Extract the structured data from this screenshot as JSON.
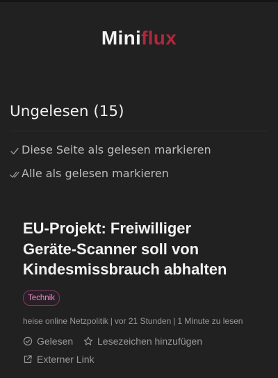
{
  "logo": {
    "part1": "Mini",
    "part2": "flux",
    "accent_color": "#b3273a"
  },
  "page": {
    "title": "Ungelesen (15)",
    "actions": [
      {
        "label": "Diese Seite als gelesen markieren",
        "icon": "check-icon"
      },
      {
        "label": "Alle als gelesen markieren",
        "icon": "double-check-icon"
      }
    ]
  },
  "entry": {
    "title_lines": [
      "EU-Projekt: Freiwilliger",
      "Geräte-Scanner soll von",
      "Kindesmissbrauch abhalten"
    ],
    "category": "Technik",
    "feed": "heise online Netzpolitik",
    "time": "vor 21 Stunden",
    "reading_time": "1 Minute zu lesen",
    "separator": "|",
    "buttons": {
      "read": "Gelesen",
      "bookmark": "Lesezeichen hinzufügen",
      "external": "Externer Link"
    }
  }
}
